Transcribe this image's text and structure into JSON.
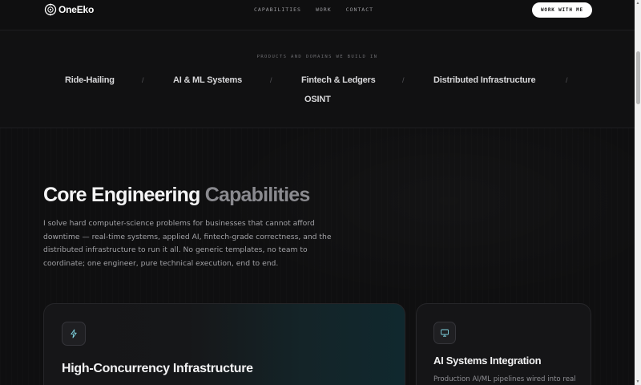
{
  "header": {
    "logo_text": "OneEko",
    "nav": [
      "CAPABILITIES",
      "WORK",
      "CONTACT"
    ],
    "cta_label": "WORK WITH ME"
  },
  "domains": {
    "label": "PRODUCTS AND DOMAINS WE BUILD IN",
    "items": [
      "Ride-Hailing",
      "AI & ML Systems",
      "Fintech & Ledgers",
      "Distributed Infrastructure",
      "OSINT"
    ],
    "separator": "/"
  },
  "hero": {
    "title_main": "Core Engineering",
    "title_muted": "Capabilities",
    "description": "I solve hard computer-science problems for businesses that cannot afford downtime — real-time systems, applied AI, fintech-grade correctness, and the distributed infrastructure to run it all. No generic templates, no team to coordinate; one engineer, pure technical execution, end to end."
  },
  "cards": [
    {
      "icon": "lightning-icon",
      "title": "High-Concurrency Infrastructure",
      "description": ""
    },
    {
      "icon": "monitor-icon",
      "title": "AI Systems Integration",
      "description": "Production AI/ML pipelines wired into real"
    }
  ],
  "colors": {
    "background": "#0f0f10",
    "accent_teal": "#10282e",
    "cta_bg": "#ffffff"
  }
}
